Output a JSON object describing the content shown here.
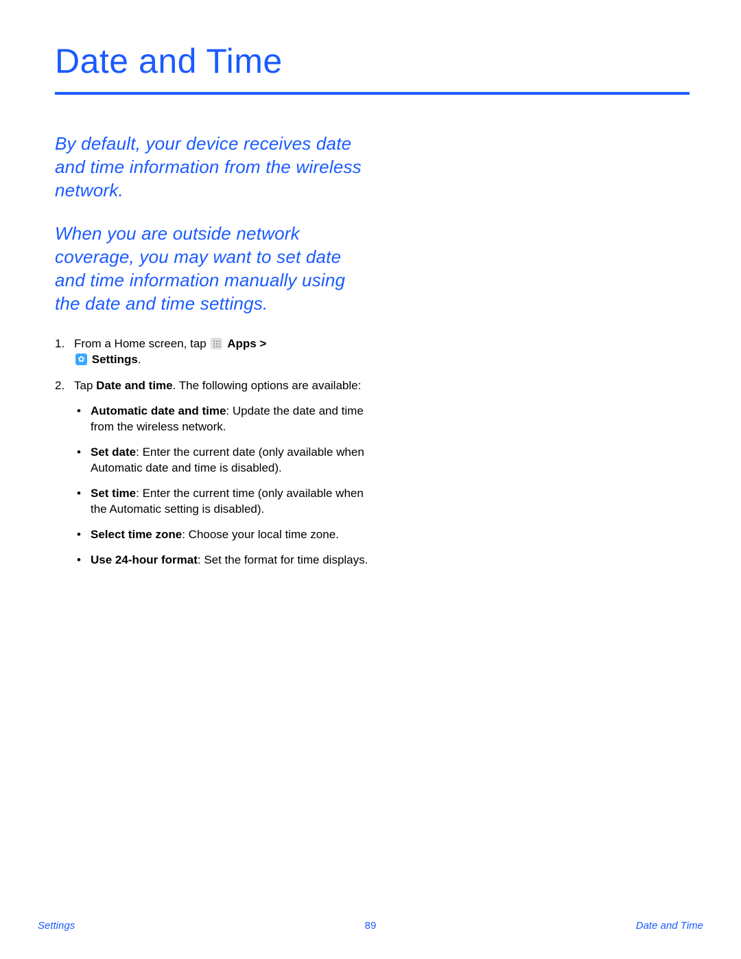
{
  "title": "Date and Time",
  "intro1": "By default, your device receives date and time information from the wireless network.",
  "intro2": "When you are outside network coverage, you may want to set date and time information manually using the date and time settings.",
  "step1": {
    "prefix": "From a Home screen, tap ",
    "apps_bold": "Apps > ",
    "settings_bold": "Settings",
    "suffix": "."
  },
  "step2": {
    "prefix": "Tap ",
    "bold": "Date and time",
    "suffix": ". The following options are available:"
  },
  "options": [
    {
      "label": "Automatic date and time",
      "desc": ": Update the date and time from the wireless network."
    },
    {
      "label": "Set date",
      "desc": ": Enter the current date (only available when Automatic date and time is disabled)."
    },
    {
      "label": "Set time",
      "desc": ": Enter the current time (only available when the Automatic setting is disabled)."
    },
    {
      "label": "Select time zone",
      "desc": ": Choose your local time zone."
    },
    {
      "label": "Use 24-hour format",
      "desc": ": Set the format for time displays."
    }
  ],
  "footer": {
    "left": "Settings",
    "center": "89",
    "right": "Date and Time"
  }
}
